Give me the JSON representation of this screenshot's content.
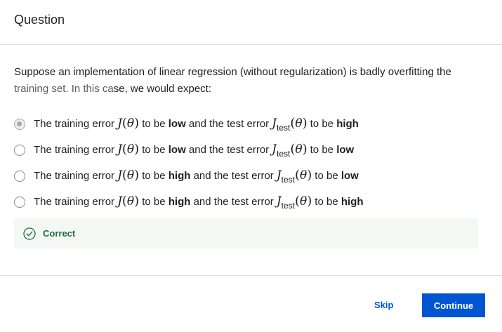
{
  "header": {
    "title": "Question"
  },
  "question": {
    "prompt_line1": "Suppose an implementation of linear regression (without regularization) is badly overfitting the",
    "prompt_line2_a": "training set. In this ca",
    "prompt_line2_b": "se, we would expect:"
  },
  "options": [
    {
      "pre": "The training error",
      "J": "J",
      "theta": "θ",
      "mid1": "to be",
      "q1": "low",
      "mid2": "and the test error",
      "Jtest": "J",
      "sub": "test",
      "end": "to be",
      "q2": "high",
      "selected": true
    },
    {
      "pre": "The training error",
      "J": "J",
      "theta": "θ",
      "mid1": "to be",
      "q1": "low",
      "mid2": "and the test error",
      "Jtest": "J",
      "sub": "test",
      "end": "to be",
      "q2": "low",
      "selected": false
    },
    {
      "pre": "The training error",
      "J": "J",
      "theta": "θ",
      "mid1": "to be",
      "q1": "high",
      "mid2": "and the test error",
      "Jtest": "J",
      "sub": "test",
      "end": "to be",
      "q2": "low",
      "selected": false
    },
    {
      "pre": "The training error",
      "J": "J",
      "theta": "θ",
      "mid1": "to be",
      "q1": "high",
      "mid2": "and the test error",
      "Jtest": "J",
      "sub": "test",
      "end": "to be",
      "q2": "high",
      "selected": false
    }
  ],
  "feedback": {
    "text": "Correct",
    "icon": "check-circle-icon",
    "color": "#1e6b3c"
  },
  "footer": {
    "skip_label": "Skip",
    "continue_label": "Continue",
    "accent": "#0056d2"
  }
}
